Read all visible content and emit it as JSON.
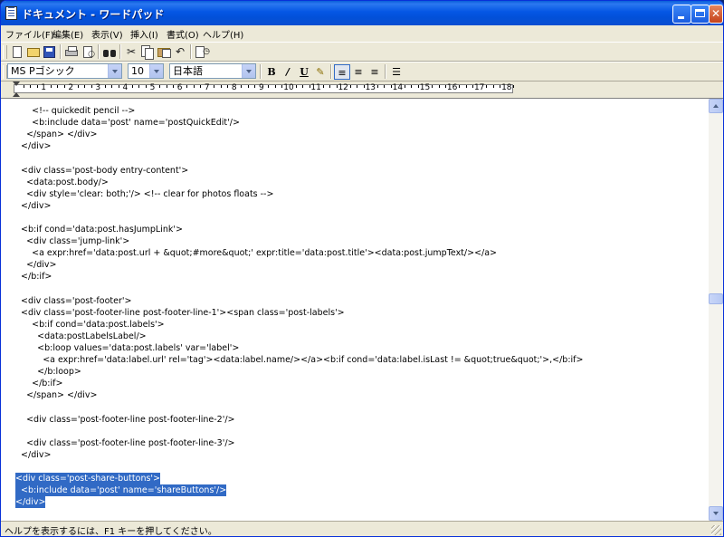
{
  "window": {
    "title": "ドキュメント - ワードパッド",
    "icon": "wordpad-document-icon"
  },
  "menu": {
    "items": [
      "ファイル(F)",
      "編集(E)",
      "表示(V)",
      "挿入(I)",
      "書式(O)",
      "ヘルプ(H)"
    ]
  },
  "toolbar": {
    "tools": [
      "new-document-icon",
      "open-folder-icon",
      "save-disk-icon",
      "print-icon",
      "print-preview-icon",
      "find-binoculars-icon",
      "cut-scissors-icon",
      "copy-icon",
      "paste-icon",
      "undo-icon",
      "insert-datetime-icon"
    ]
  },
  "format_bar": {
    "font_name": "MS Pゴシック",
    "font_size": "10",
    "script": "日本語",
    "bold": "B",
    "italic": "/",
    "underline": "U",
    "color_icon": "font-color-icon",
    "align_left_active": true,
    "bullets_icon": "bullets-icon"
  },
  "ruler": {
    "labels": [
      "1",
      "2",
      "3",
      "4",
      "5",
      "6",
      "7",
      "8",
      "9",
      "10",
      "11",
      "12",
      "13",
      "14",
      "15",
      "16",
      "17",
      "18"
    ]
  },
  "document": {
    "lines": [
      {
        "text": "      <!-- quickedit pencil -->",
        "selected": false
      },
      {
        "text": "      <b:include data='post' name='postQuickEdit'/>",
        "selected": false
      },
      {
        "text": "    </span> </div>",
        "selected": false
      },
      {
        "text": "  </div>",
        "selected": false
      },
      {
        "text": "",
        "selected": false
      },
      {
        "text": "  <div class='post-body entry-content'>",
        "selected": false
      },
      {
        "text": "    <data:post.body/>",
        "selected": false
      },
      {
        "text": "    <div style='clear: both;'/> <!-- clear for photos floats -->",
        "selected": false
      },
      {
        "text": "  </div>",
        "selected": false
      },
      {
        "text": "",
        "selected": false
      },
      {
        "text": "  <b:if cond='data:post.hasJumpLink'>",
        "selected": false
      },
      {
        "text": "    <div class='jump-link'>",
        "selected": false
      },
      {
        "text": "      <a expr:href='data:post.url + &quot;#more&quot;' expr:title='data:post.title'><data:post.jumpText/></a>",
        "selected": false
      },
      {
        "text": "    </div>",
        "selected": false
      },
      {
        "text": "  </b:if>",
        "selected": false
      },
      {
        "text": "",
        "selected": false
      },
      {
        "text": "  <div class='post-footer'>",
        "selected": false
      },
      {
        "text": "  <div class='post-footer-line post-footer-line-1'><span class='post-labels'>",
        "selected": false
      },
      {
        "text": "      <b:if cond='data:post.labels'>",
        "selected": false
      },
      {
        "text": "        <data:postLabelsLabel/>",
        "selected": false
      },
      {
        "text": "        <b:loop values='data:post.labels' var='label'>",
        "selected": false
      },
      {
        "text": "          <a expr:href='data:label.url' rel='tag'><data:label.name/></a><b:if cond='data:label.isLast != &quot;true&quot;'>,</b:if>",
        "selected": false
      },
      {
        "text": "        </b:loop>",
        "selected": false
      },
      {
        "text": "      </b:if>",
        "selected": false
      },
      {
        "text": "    </span> </div>",
        "selected": false
      },
      {
        "text": "",
        "selected": false
      },
      {
        "text": "    <div class='post-footer-line post-footer-line-2'/>",
        "selected": false
      },
      {
        "text": "",
        "selected": false
      },
      {
        "text": "    <div class='post-footer-line post-footer-line-3'/>",
        "selected": false
      },
      {
        "text": "  </div>",
        "selected": false
      },
      {
        "text": "",
        "selected": false
      },
      {
        "text": "<div class='post-share-buttons'>",
        "selected": true
      },
      {
        "text": "  <b:include data='post' name='shareButtons'/>",
        "selected": true
      },
      {
        "text": "</div>",
        "selected": true
      }
    ]
  },
  "status": {
    "text": "ヘルプを表示するには、F1 キーを押してください。"
  },
  "colors": {
    "titlebar": "#0054e3",
    "selection": "#316ac5",
    "chrome": "#ece9d8"
  }
}
